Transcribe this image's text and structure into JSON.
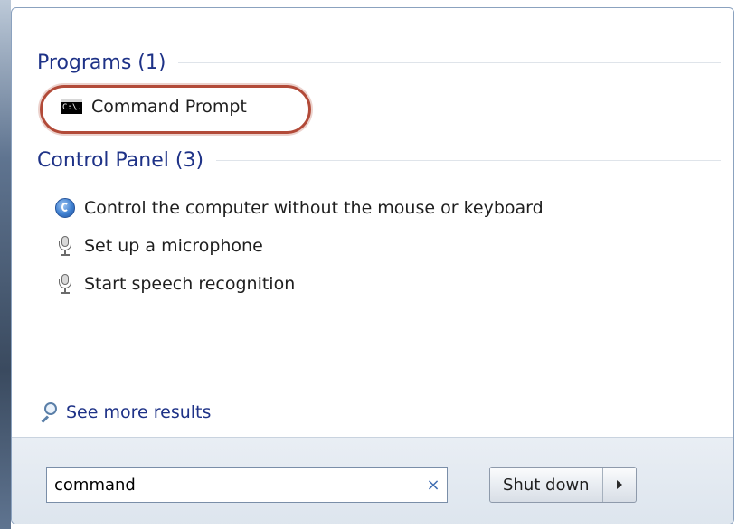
{
  "programs": {
    "header": "Programs (1)",
    "items": [
      {
        "label": "Command Prompt",
        "icon": "command-prompt-icon",
        "icon_text": "C:\\."
      }
    ]
  },
  "control_panel": {
    "header": "Control Panel (3)",
    "items": [
      {
        "label": "Control the computer without the mouse or keyboard",
        "icon": "ease-of-access-icon"
      },
      {
        "label": "Set up a microphone",
        "icon": "microphone-icon"
      },
      {
        "label": "Start speech recognition",
        "icon": "microphone-icon"
      }
    ]
  },
  "see_more": {
    "label": "See more results",
    "icon": "search-icon"
  },
  "search": {
    "value": "command",
    "clear_glyph": "×"
  },
  "shutdown": {
    "label": "Shut down"
  },
  "colors": {
    "header": "#1e3287",
    "highlight_ring": "#b24a38"
  }
}
